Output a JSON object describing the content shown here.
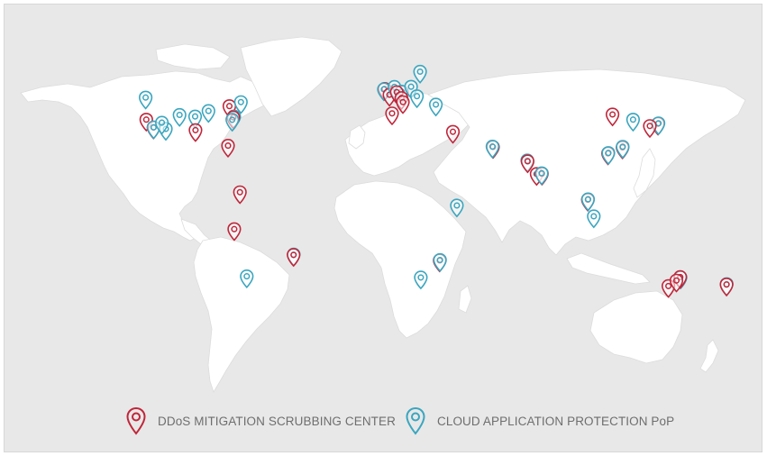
{
  "colors": {
    "background": "#e8e8e8",
    "land": "#ffffff",
    "ddos_marker": "#c0263a",
    "cloud_marker": "#3aa6bf",
    "legend_text": "#6e6e6e"
  },
  "legend": {
    "ddos": {
      "label": "DDoS MITIGATION SCRUBBING CENTER",
      "icon": "map-pin-icon"
    },
    "cloud": {
      "label": "CLOUD APPLICATION PROTECTION PoP",
      "icon": "map-pin-icon"
    }
  },
  "map": {
    "projection": "equirectangular-approx",
    "markers": [
      {
        "type": "cloud",
        "lon": -122.3,
        "lat": 47.6
      },
      {
        "type": "ddos",
        "lon": -122.0,
        "lat": 37.6
      },
      {
        "type": "ddos",
        "lon": -118.3,
        "lat": 34.0
      },
      {
        "type": "cloud",
        "lon": -118.2,
        "lat": 34.1
      },
      {
        "type": "cloud",
        "lon": -112.0,
        "lat": 33.4
      },
      {
        "type": "cloud",
        "lon": -105.0,
        "lat": 39.7
      },
      {
        "type": "cloud",
        "lon": -114.0,
        "lat": 36.2
      },
      {
        "type": "cloud",
        "lon": -97.0,
        "lat": 39.0
      },
      {
        "type": "ddos",
        "lon": -96.8,
        "lat": 32.8
      },
      {
        "type": "cloud",
        "lon": -90.2,
        "lat": 41.5
      },
      {
        "type": "ddos",
        "lon": -79.5,
        "lat": 43.7
      },
      {
        "type": "cloud",
        "lon": -73.6,
        "lat": 45.5
      },
      {
        "type": "ddos",
        "lon": -77.2,
        "lat": 39.0
      },
      {
        "type": "cloud",
        "lon": -77.0,
        "lat": 38.9
      },
      {
        "type": "ddos",
        "lon": -77.5,
        "lat": 38.6
      },
      {
        "type": "cloud",
        "lon": -78.0,
        "lat": 37.5
      },
      {
        "type": "ddos",
        "lon": -80.2,
        "lat": 25.8
      },
      {
        "type": "ddos",
        "lon": -74.1,
        "lat": 4.7
      },
      {
        "type": "ddos",
        "lon": -77.0,
        "lat": -12.0
      },
      {
        "type": "cloud",
        "lon": -46.6,
        "lat": -23.5
      },
      {
        "type": "ddos",
        "lon": -46.7,
        "lat": -23.7
      },
      {
        "type": "cloud",
        "lon": -70.6,
        "lat": -33.4
      },
      {
        "type": "ddos",
        "lon": -0.1,
        "lat": 51.5
      },
      {
        "type": "cloud",
        "lon": -0.5,
        "lat": 51.3
      },
      {
        "type": "ddos",
        "lon": 2.35,
        "lat": 48.85
      },
      {
        "type": "cloud",
        "lon": 4.9,
        "lat": 52.4
      },
      {
        "type": "ddos",
        "lon": 8.7,
        "lat": 50.1
      },
      {
        "type": "cloud",
        "lon": 8.5,
        "lat": 50.3
      },
      {
        "type": "ddos",
        "lon": 6.1,
        "lat": 50.0
      },
      {
        "type": "cloud",
        "lon": 13.4,
        "lat": 52.5
      },
      {
        "type": "ddos",
        "lon": 8.5,
        "lat": 47.4
      },
      {
        "type": "ddos",
        "lon": 3.7,
        "lat": 40.4
      },
      {
        "type": "ddos",
        "lon": 9.2,
        "lat": 45.5
      },
      {
        "type": "cloud",
        "lon": 16.4,
        "lat": 48.2
      },
      {
        "type": "cloud",
        "lon": 18.0,
        "lat": 59.3
      },
      {
        "type": "cloud",
        "lon": 26.1,
        "lat": 44.4
      },
      {
        "type": "ddos",
        "lon": 34.8,
        "lat": 32.1
      },
      {
        "type": "ddos",
        "lon": 55.3,
        "lat": 25.2
      },
      {
        "type": "cloud",
        "lon": 55.0,
        "lat": 25.4
      },
      {
        "type": "cloud",
        "lon": 72.8,
        "lat": 19.1
      },
      {
        "type": "ddos",
        "lon": 73.0,
        "lat": 18.7
      },
      {
        "type": "ddos",
        "lon": 77.6,
        "lat": 13.0
      },
      {
        "type": "ddos",
        "lon": 80.3,
        "lat": 13.1
      },
      {
        "type": "cloud",
        "lon": 80.2,
        "lat": 13.3
      },
      {
        "type": "cloud",
        "lon": 36.8,
        "lat": -1.3
      },
      {
        "type": "ddos",
        "lon": 28.0,
        "lat": -26.2
      },
      {
        "type": "cloud",
        "lon": 28.2,
        "lat": -26.0
      },
      {
        "type": "cloud",
        "lon": 18.4,
        "lat": -33.9
      },
      {
        "type": "ddos",
        "lon": 103.8,
        "lat": 1.3
      },
      {
        "type": "cloud",
        "lon": 103.9,
        "lat": 1.5
      },
      {
        "type": "cloud",
        "lon": 106.8,
        "lat": -6.2
      },
      {
        "type": "ddos",
        "lon": 114.1,
        "lat": 22.3
      },
      {
        "type": "cloud",
        "lon": 114.3,
        "lat": 22.5
      },
      {
        "type": "ddos",
        "lon": 121.5,
        "lat": 25.0
      },
      {
        "type": "cloud",
        "lon": 121.6,
        "lat": 25.3
      },
      {
        "type": "ddos",
        "lon": 116.4,
        "lat": 39.9
      },
      {
        "type": "cloud",
        "lon": 126.9,
        "lat": 37.6
      },
      {
        "type": "ddos",
        "lon": 139.7,
        "lat": 35.7
      },
      {
        "type": "cloud",
        "lon": 139.9,
        "lat": 35.9
      },
      {
        "type": "ddos",
        "lon": 135.5,
        "lat": 34.7
      },
      {
        "type": "cloud",
        "lon": 151.2,
        "lat": -33.9
      },
      {
        "type": "ddos",
        "lon": 151.0,
        "lat": -33.7
      },
      {
        "type": "ddos",
        "lon": 145.0,
        "lat": -37.8
      },
      {
        "type": "ddos",
        "lon": 149.1,
        "lat": -35.3
      },
      {
        "type": "cloud",
        "lon": 174.8,
        "lat": -36.9
      },
      {
        "type": "ddos",
        "lon": 174.7,
        "lat": -37.1
      }
    ]
  }
}
